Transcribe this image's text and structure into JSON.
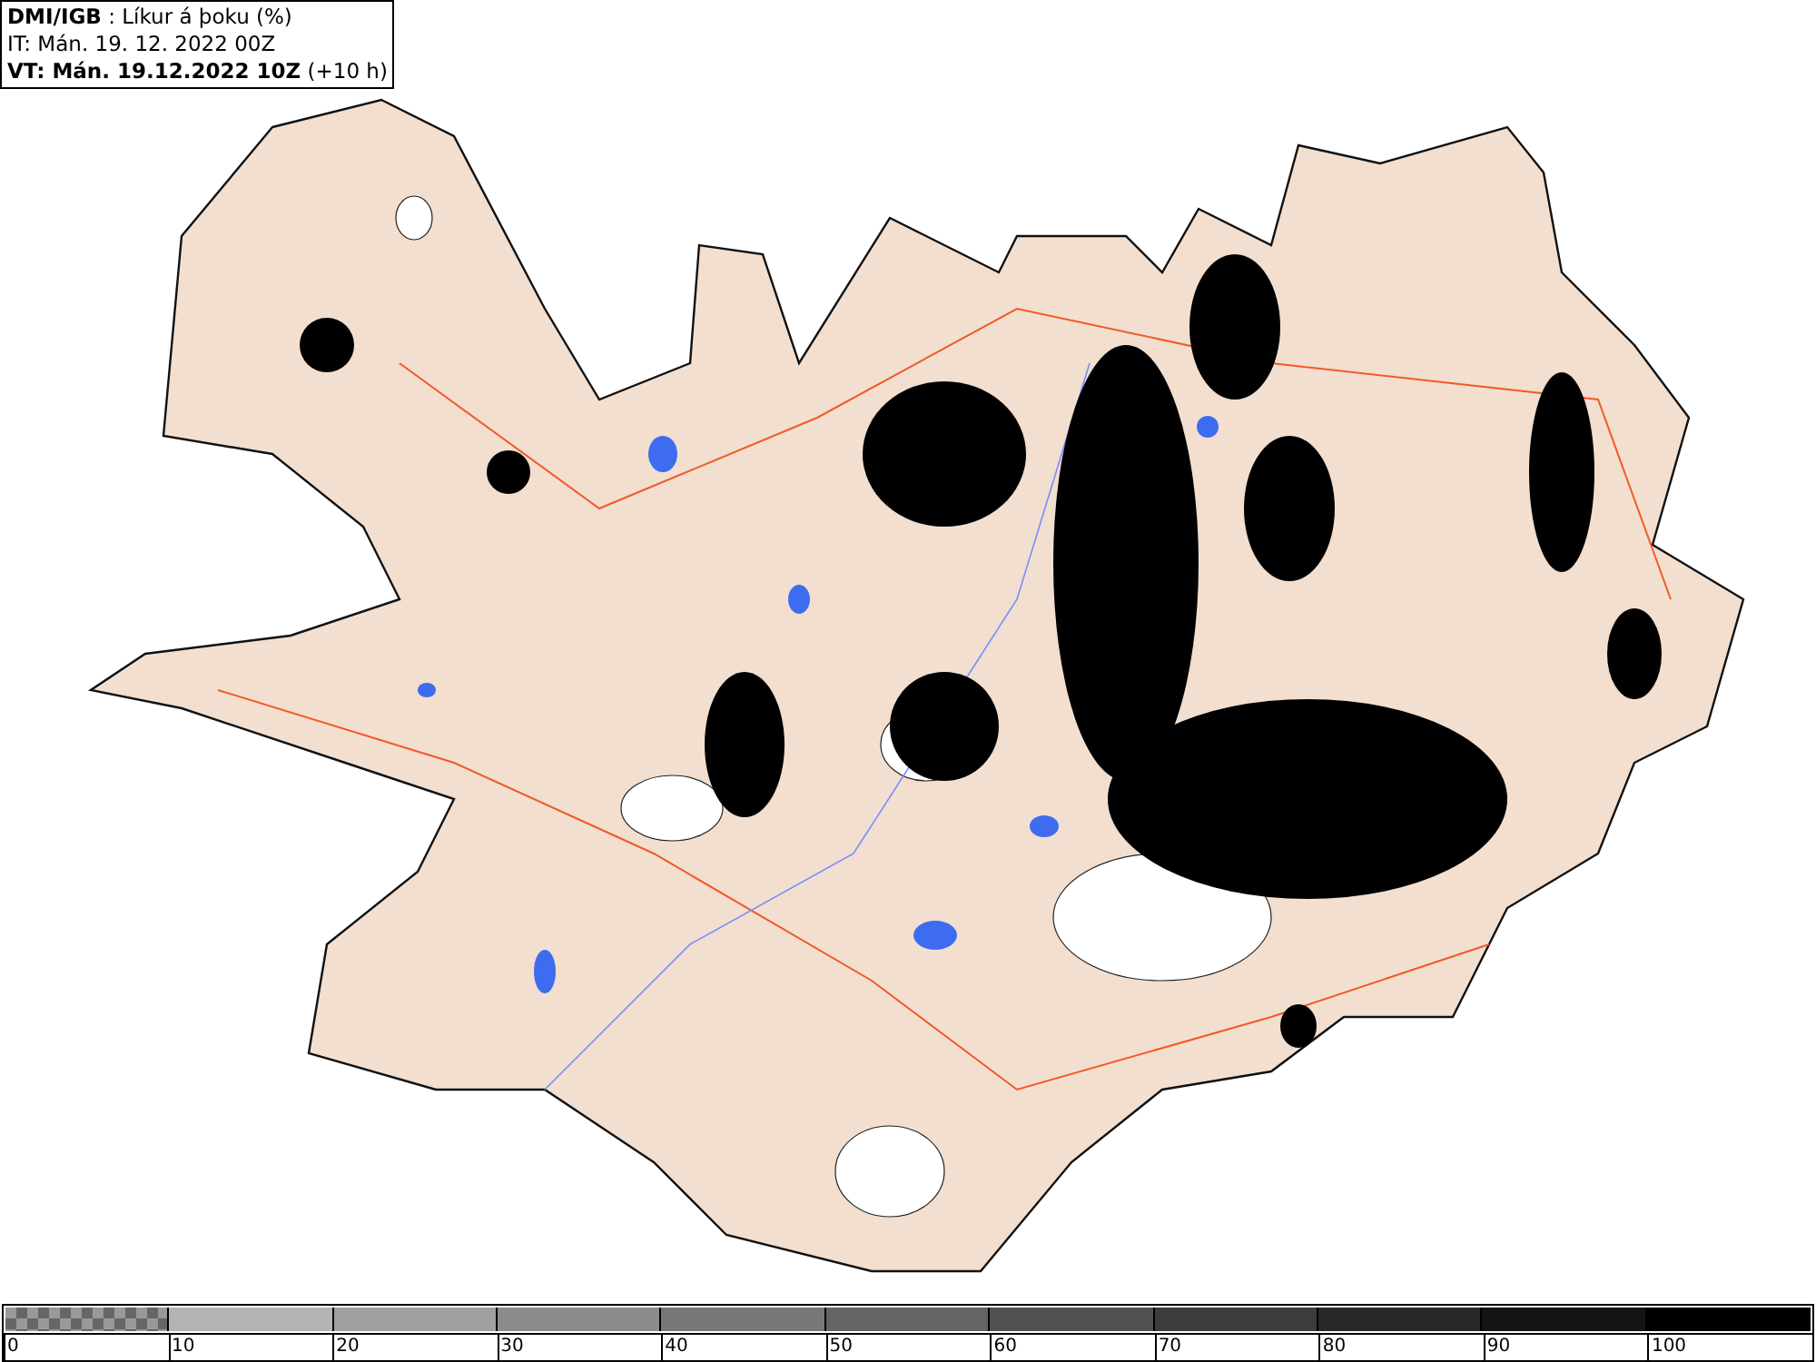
{
  "header": {
    "lines": [
      "**DMI/IGB** : Líkur á þoku (%)",
      "IT: Mán. 19. 12. 2022 00Z",
      "**VT: Mán. 19.12.2022 10Z** (+10 h)"
    ]
  },
  "legend": {
    "segments": [
      {
        "kind": "checker"
      },
      {
        "kind": "solid",
        "color": "#b4b4b4"
      },
      {
        "kind": "solid",
        "color": "#a0a0a0"
      },
      {
        "kind": "solid",
        "color": "#8c8c8c"
      },
      {
        "kind": "solid",
        "color": "#787878"
      },
      {
        "kind": "solid",
        "color": "#646464"
      },
      {
        "kind": "solid",
        "color": "#505050"
      },
      {
        "kind": "solid",
        "color": "#3c3c3c"
      },
      {
        "kind": "solid",
        "color": "#282828"
      },
      {
        "kind": "solid",
        "color": "#141414"
      },
      {
        "kind": "solid",
        "color": "#000000"
      }
    ],
    "labels": [
      "0",
      "10",
      "20",
      "30",
      "40",
      "50",
      "60",
      "70",
      "80",
      "90",
      "100"
    ]
  }
}
